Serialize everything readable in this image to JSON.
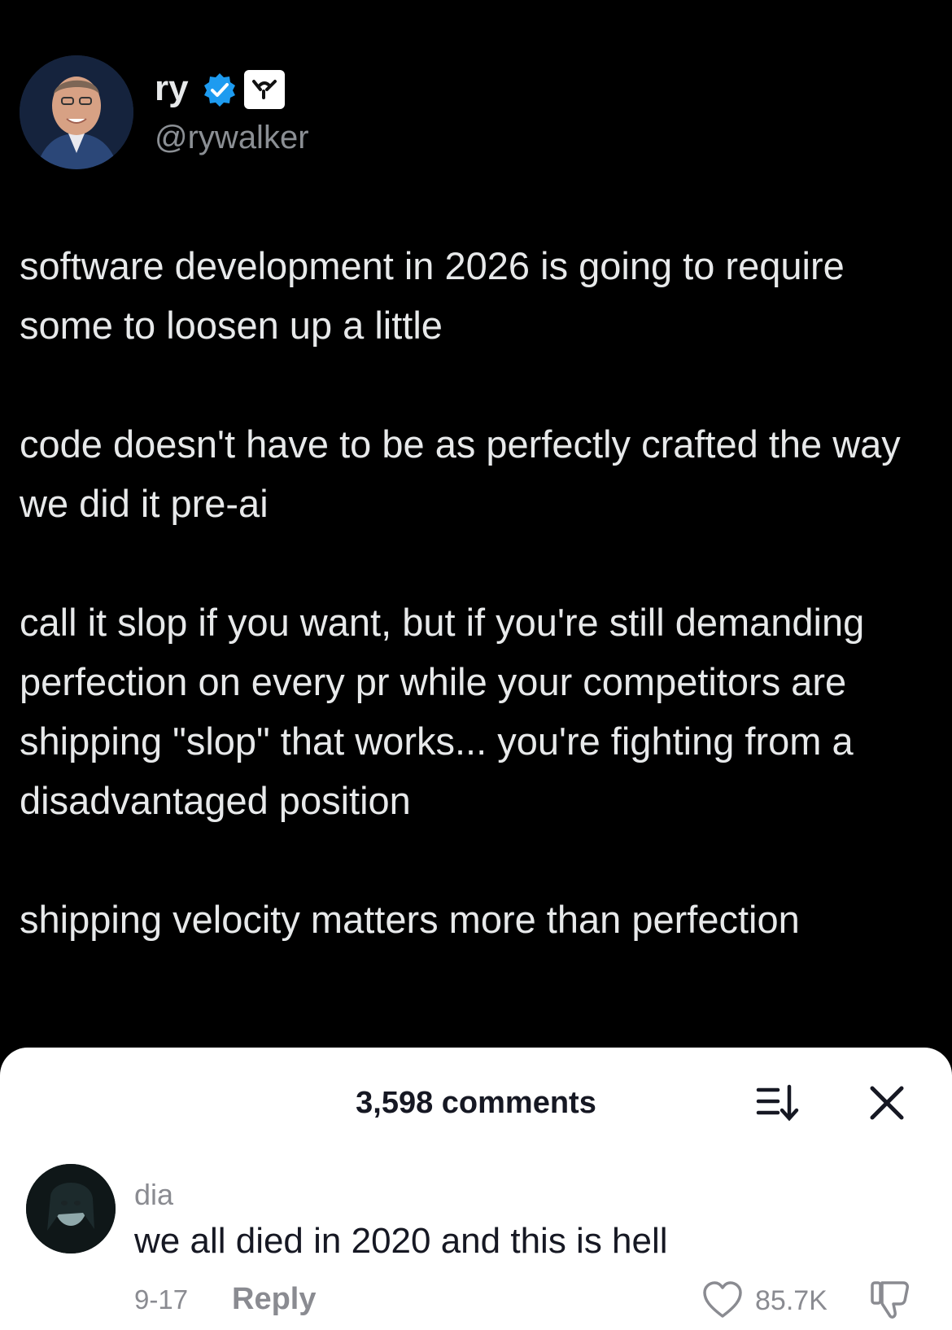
{
  "tweet": {
    "author": {
      "display_name": "ry",
      "handle": "@rywalker",
      "verified": true,
      "avatar_icon": "profile-photo"
    },
    "paragraphs": [
      "software development in 2026 is going to require some to loosen up a little",
      "code doesn't have to be as perfectly crafted the way we did it pre-ai",
      "call it slop if you want, but if you're still demanding perfection on every pr while your competitors are shipping \"slop\" that works... you're fighting from a disadvantaged position",
      "shipping velocity matters more than perfection"
    ]
  },
  "comments_sheet": {
    "title": "3,598 comments",
    "sort_icon": "sort-icon",
    "close_icon": "close-icon",
    "comments": [
      {
        "author": "dia",
        "text": "we all died in 2020 and this is hell",
        "date": "9-17",
        "reply_label": "Reply",
        "like_count": "85.7K"
      }
    ]
  },
  "colors": {
    "background": "#000000",
    "tweet_text": "#e7e9ea",
    "handle": "#8b8f94",
    "verified_blue": "#1d9bf0",
    "sheet_background": "#ffffff",
    "sheet_text": "#161823",
    "sheet_muted": "#8a8b91"
  }
}
